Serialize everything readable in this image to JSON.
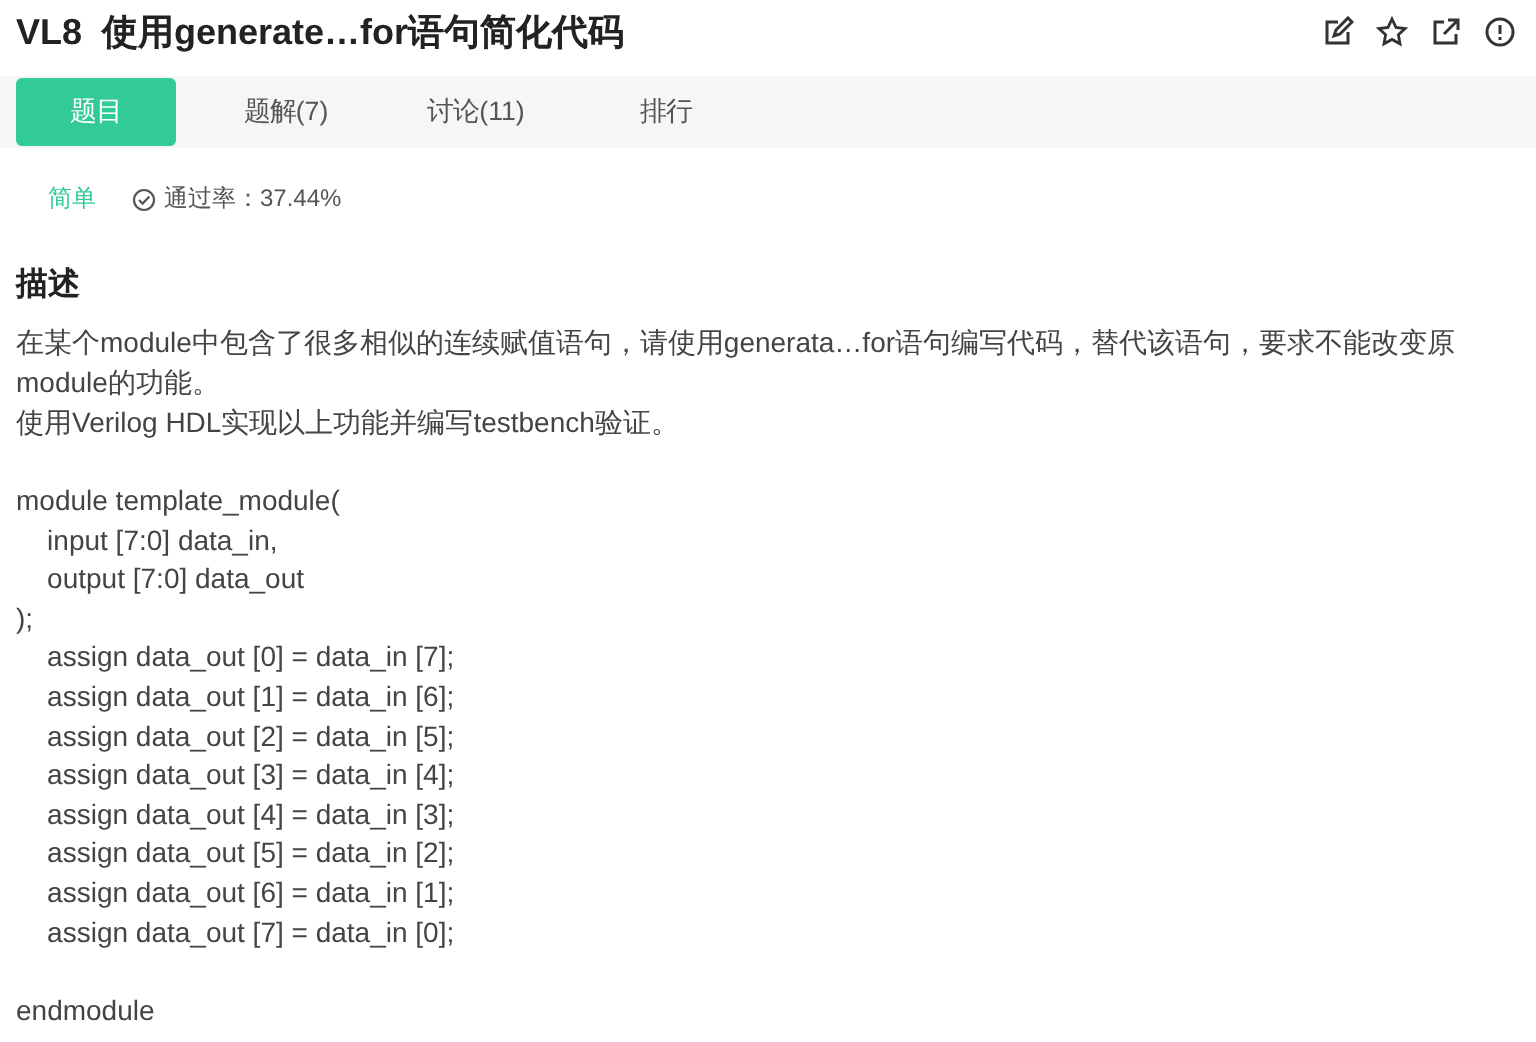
{
  "title": "VL8  使用generate…for语句简化代码",
  "tabs": [
    {
      "label": "题目",
      "selected": true
    },
    {
      "label": "题解(7)",
      "selected": false
    },
    {
      "label": "讨论(11)",
      "selected": false
    },
    {
      "label": "排行",
      "selected": false
    }
  ],
  "difficulty": "简单",
  "pass_rate": "通过率：37.44%",
  "section_title": "描述",
  "paragraphs": [
    "在某个module中包含了很多相似的连续赋值语句，请使用generata…for语句编写代码，替代该语句，要求不能改变原module的功能。",
    "使用Verilog HDL实现以上功能并编写testbench验证。"
  ],
  "code_blocks": [
    [
      "module template_module(",
      "    input [7:0] data_in,",
      "    output [7:0] data_out",
      ");",
      "    assign data_out [0] = data_in [7];",
      "    assign data_out [1] = data_in [6];",
      "    assign data_out [2] = data_in [5];",
      "    assign data_out [3] = data_in [4];",
      "    assign data_out [4] = data_in [3];",
      "    assign data_out [5] = data_in [2];",
      "    assign data_out [6] = data_in [1];",
      "    assign data_out [7] = data_in [0];"
    ],
    [
      "endmodule"
    ]
  ]
}
